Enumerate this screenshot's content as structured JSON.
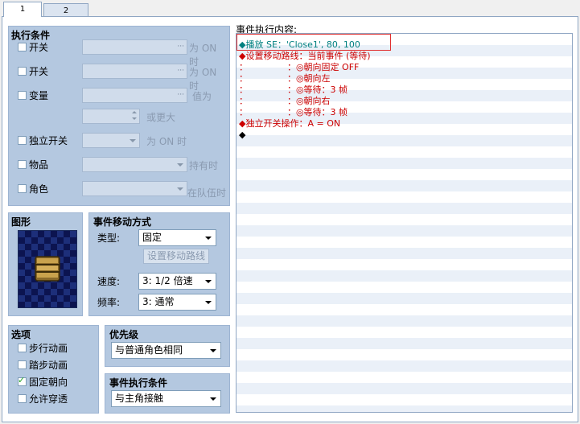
{
  "tabs": [
    {
      "label": "1",
      "active": true
    },
    {
      "label": "2",
      "active": false
    }
  ],
  "conditions": {
    "title": "执行条件",
    "switch1_label": "开关",
    "switch1_suffix": "为 ON 时",
    "switch2_label": "开关",
    "switch2_suffix": "为 ON 时",
    "variable_label": "变量",
    "variable_suffix": "值为",
    "variable_more": "或更大",
    "self_switch_label": "独立开关",
    "self_switch_suffix": "为 ON 时",
    "item_label": "物品",
    "item_suffix": "持有时",
    "actor_label": "角色",
    "actor_suffix": "在队伍时",
    "dots": "···"
  },
  "graphic": {
    "title": "图形"
  },
  "movement": {
    "title": "事件移动方式",
    "type_label": "类型:",
    "type_value": "固定",
    "route_button": "设置移动路线",
    "speed_label": "速度:",
    "speed_value": "3: 1/2 倍速",
    "freq_label": "频率:",
    "freq_value": "3: 通常"
  },
  "options": {
    "title": "选项",
    "walk": "步行动画",
    "step": "踏步动画",
    "direction_fix": "固定朝向",
    "through": "允许穿透",
    "checked": {
      "walk": false,
      "step": false,
      "direction_fix": true,
      "through": false
    }
  },
  "priority": {
    "title": "优先级",
    "value": "与普通角色相同"
  },
  "trigger": {
    "title": "事件执行条件",
    "value": "与主角接触"
  },
  "contents": {
    "title": "事件执行内容:",
    "rows": [
      {
        "text": "◆播放 SE：'Close1', 80, 100",
        "color": "#008080"
      },
      {
        "text": "◆设置移动路线：当前事件 (等待)",
        "color": "#cc0000"
      },
      {
        "text": "：              ：◎朝向固定 OFF",
        "color": "#cc0000"
      },
      {
        "text": "：              ：◎朝向左",
        "color": "#cc0000"
      },
      {
        "text": "：              ：◎等待：3 帧",
        "color": "#cc0000"
      },
      {
        "text": "：              ：◎朝向右",
        "color": "#cc0000"
      },
      {
        "text": "：              ：◎等待：3 帧",
        "color": "#cc0000"
      },
      {
        "text": "◆独立开关操作：A = ON",
        "color": "#cc0000"
      },
      {
        "text": "◆",
        "color": "#000000"
      }
    ]
  },
  "colors": {
    "highlight_border": "#e03030",
    "panel": "#b4c8e0"
  }
}
